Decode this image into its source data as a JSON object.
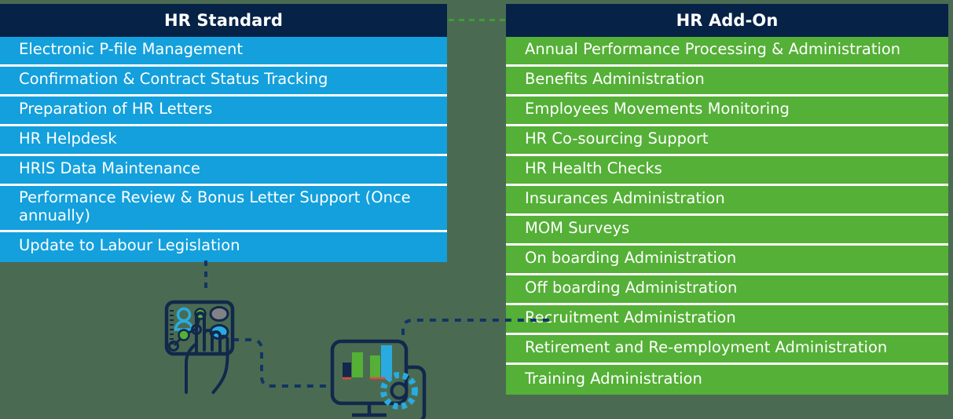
{
  "colors": {
    "background": "#4a6b52",
    "header_navy": "#062246",
    "standard_blue": "#13a0dc",
    "addon_green": "#54b036",
    "divider_white": "#ffffff",
    "connector_green": "#3f9c35",
    "connector_navy": "#123564",
    "icon_cyan": "#29abe2",
    "icon_green": "#54b036",
    "icon_gray": "#808285",
    "icon_dark": "#12284c"
  },
  "columns": [
    {
      "id": "hr-standard",
      "title": "HR Standard",
      "rows": [
        "Electronic P-file Management",
        "Confirmation & Contract Status Tracking",
        "Preparation of HR Letters",
        "HR Helpdesk",
        "HRIS Data Maintenance",
        "Performance Review & Bonus Letter Support (Once annually)",
        "Update to Labour Legislation"
      ]
    },
    {
      "id": "hr-add-on",
      "title": "HR Add-On",
      "rows": [
        "Annual Performance Processing & Administration",
        "Benefits Administration",
        "Employees Movements Monitoring",
        "HR Co-sourcing Support",
        "HR Health Checks",
        "Insurances Administration",
        "MOM Surveys",
        "On boarding Administration",
        "Off boarding Administration",
        "Recruitment Administration",
        "Retirement and Re-employment Administration",
        "Training Administration"
      ]
    }
  ],
  "illustration": {
    "hand_tablet_icon": "hand-tapping-tablet-icon",
    "dashboard_icon": "computer-dashboard-gear-icon",
    "connectors": [
      "standard-column-to-tablet",
      "tablet-to-dashboard",
      "dashboard-to-addon-column",
      "standard-header-to-addon-header"
    ]
  }
}
